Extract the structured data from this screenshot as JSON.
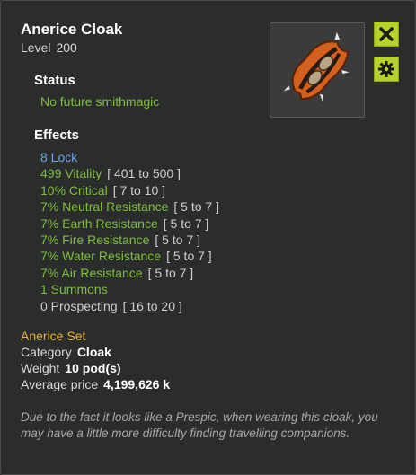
{
  "item": {
    "name": "Anerice Cloak",
    "level_label": "Level",
    "level_value": "200"
  },
  "status": {
    "heading": "Status",
    "text": "No future smithmagic"
  },
  "effects": {
    "heading": "Effects",
    "list": [
      {
        "text": "8 Lock",
        "range": "",
        "color": "#6aa7e8"
      },
      {
        "text": "499 Vitality",
        "range": "[ 401 to 500 ]",
        "color": "#7fbf3d"
      },
      {
        "text": "10% Critical",
        "range": "[ 7 to 10 ]",
        "color": "#7fbf3d"
      },
      {
        "text": "7% Neutral Resistance",
        "range": "[ 5 to 7 ]",
        "color": "#7fbf3d"
      },
      {
        "text": "7% Earth Resistance",
        "range": "[ 5 to 7 ]",
        "color": "#7fbf3d"
      },
      {
        "text": "7% Fire Resistance",
        "range": "[ 5 to 7 ]",
        "color": "#7fbf3d"
      },
      {
        "text": "7% Water Resistance",
        "range": "[ 5 to 7 ]",
        "color": "#7fbf3d"
      },
      {
        "text": "7% Air Resistance",
        "range": "[ 5 to 7 ]",
        "color": "#7fbf3d"
      },
      {
        "text": "1 Summons",
        "range": "",
        "color": "#7fbf3d"
      },
      {
        "text": "0 Prospecting",
        "range": "[ 16 to 20 ]",
        "color": "#cfcfcf"
      }
    ]
  },
  "set": {
    "name": "Anerice Set"
  },
  "details": {
    "category_label": "Category",
    "category_value": "Cloak",
    "weight_label": "Weight",
    "weight_value": "10 pod(s)",
    "price_label": "Average price",
    "price_value": "4,199,626 k"
  },
  "description": "Due to the fact it looks like a Prespic, when wearing this cloak, you may have a little more difficulty finding travelling companions.",
  "buttons": {
    "close_icon": "close-x-icon",
    "settings_icon": "gear-icon"
  },
  "colors": {
    "accent_button": "#b6d22b",
    "bonus_green": "#7fbf3d",
    "lock_blue": "#6aa7e8",
    "set_gold": "#e8b43a"
  }
}
